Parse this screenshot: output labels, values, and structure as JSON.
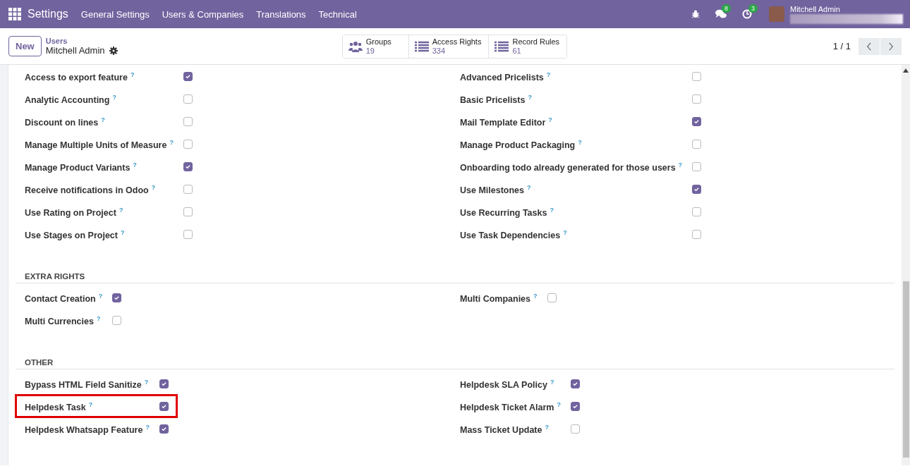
{
  "navbar": {
    "app": "Settings",
    "menus": [
      "General Settings",
      "Users & Companies",
      "Translations",
      "Technical"
    ],
    "messages_badge": "8",
    "activities_badge": "3",
    "user": "Mitchell Admin"
  },
  "control_panel": {
    "new_button": "New",
    "breadcrumb": "Users",
    "record": "Mitchell Admin",
    "stats": [
      {
        "label": "Groups",
        "value": "19"
      },
      {
        "label": "Access Rights",
        "value": "334"
      },
      {
        "label": "Record Rules",
        "value": "61"
      }
    ],
    "pager": "1 / 1"
  },
  "sections": [
    {
      "left": [
        {
          "label": "Access to export feature",
          "help": "?",
          "checked": true
        },
        {
          "label": "Analytic Accounting",
          "help": "?",
          "checked": false
        },
        {
          "label": "Discount on lines",
          "help": "?",
          "checked": false
        },
        {
          "label": "Manage Multiple Units of Measure",
          "help": "?",
          "checked": false
        },
        {
          "label": "Manage Product Variants",
          "help": "?",
          "checked": true
        },
        {
          "label": "Receive notifications in Odoo",
          "help": "?",
          "checked": false
        },
        {
          "label": "Use Rating on Project",
          "help": "?",
          "checked": false
        },
        {
          "label": "Use Stages on Project",
          "help": "?",
          "checked": false
        }
      ],
      "right": [
        {
          "label": "Advanced Pricelists",
          "help": "?",
          "checked": false
        },
        {
          "label": "Basic Pricelists",
          "help": "?",
          "checked": false
        },
        {
          "label": "Mail Template Editor",
          "help": "?",
          "checked": true
        },
        {
          "label": "Manage Product Packaging",
          "help": "?",
          "checked": false
        },
        {
          "label": "Onboarding todo already generated for those users",
          "help": "?",
          "checked": false
        },
        {
          "label": "Use Milestones",
          "help": "?",
          "checked": true
        },
        {
          "label": "Use Recurring Tasks",
          "help": "?",
          "checked": false
        },
        {
          "label": "Use Task Dependencies",
          "help": "?",
          "checked": false
        }
      ]
    },
    {
      "title": "EXTRA RIGHTS",
      "left": [
        {
          "label": "Contact Creation",
          "help": "?",
          "checked": true
        },
        {
          "label": "Multi Currencies",
          "help": "?",
          "checked": false
        }
      ],
      "right": [
        {
          "label": "Multi Companies",
          "help": "?",
          "checked": false
        }
      ]
    },
    {
      "title": "OTHER",
      "left": [
        {
          "label": "Bypass HTML Field Sanitize",
          "help": "?",
          "checked": true
        },
        {
          "label": "Helpdesk Task",
          "help": "?",
          "checked": true,
          "highlighted": true
        },
        {
          "label": "Helpdesk Whatsapp Feature",
          "help": "?",
          "checked": true
        }
      ],
      "right": [
        {
          "label": "Helpdesk SLA Policy",
          "help": "?",
          "checked": true
        },
        {
          "label": "Helpdesk Ticket Alarm",
          "help": "?",
          "checked": true
        },
        {
          "label": "Mass Ticket Update",
          "help": "?",
          "checked": false
        }
      ]
    }
  ]
}
